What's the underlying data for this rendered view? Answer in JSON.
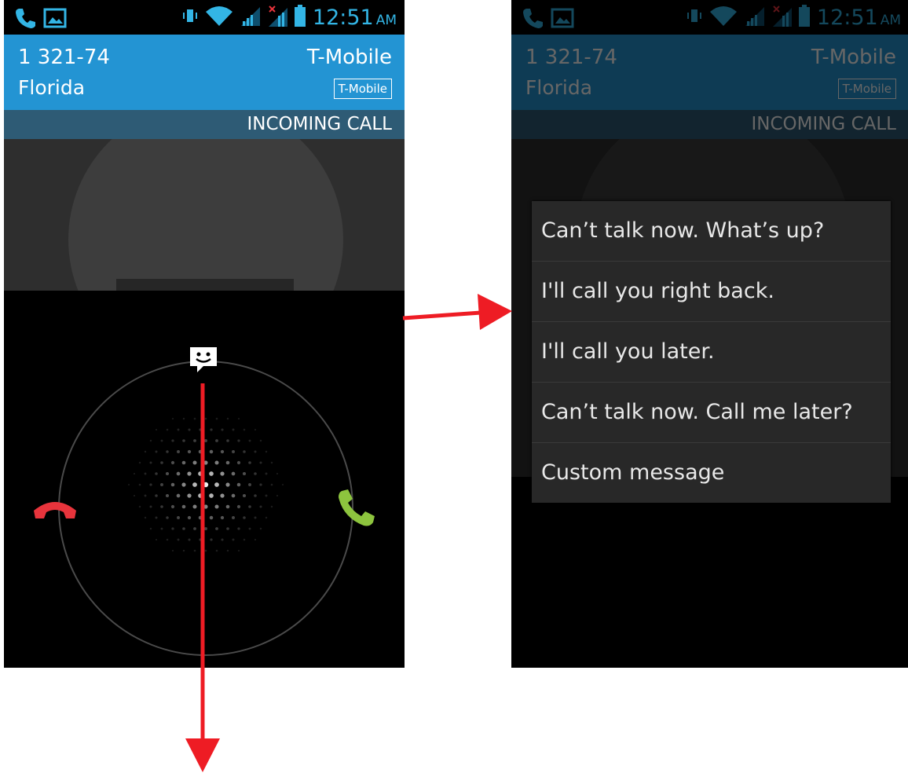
{
  "status_bar": {
    "time": "12:51",
    "ampm": "AM",
    "icons": [
      "phone-icon",
      "image-icon",
      "vibrate-icon",
      "wifi-icon",
      "signal-icon",
      "no-signal-icon",
      "battery-icon"
    ]
  },
  "caller": {
    "number": "1 321-74",
    "location": "Florida",
    "carrier": "T-Mobile",
    "carrier_badge": "T-Mobile"
  },
  "call_state": "INCOMING CALL",
  "quick_responses": [
    "Can’t talk now. What’s up?",
    "I'll call you right back.",
    "I'll call you later.",
    "Can’t talk now. Call me later?",
    "Custom message"
  ],
  "colors": {
    "caller_bar": "#2394d3",
    "decline": "#e8343c",
    "answer": "#8dc43e",
    "annotation_arrow": "#ee1c24",
    "status_icons": "#33b5e5"
  }
}
